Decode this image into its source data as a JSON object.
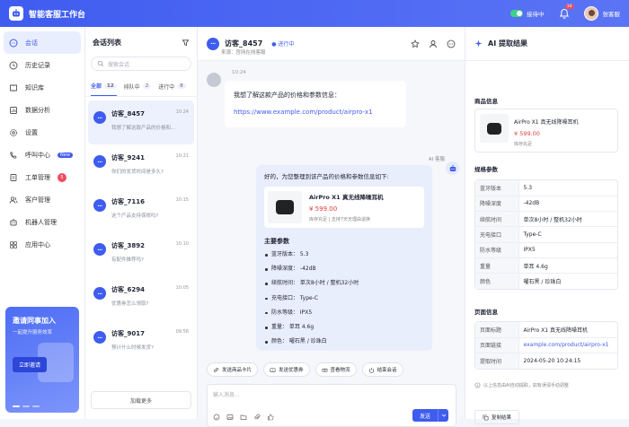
{
  "app": {
    "title": "智能客服工作台"
  },
  "header": {
    "status_label": "接待中",
    "notification_count": "10",
    "username": "张客服"
  },
  "sidebar": {
    "items": [
      {
        "label": "会话",
        "icon": "chat-icon"
      },
      {
        "label": "历史记录",
        "icon": "clock-icon"
      },
      {
        "label": "知识库",
        "icon": "book-icon"
      },
      {
        "label": "数据分析",
        "icon": "chart-icon"
      },
      {
        "label": "设置",
        "icon": "gear-icon"
      },
      {
        "label": "呼叫中心",
        "icon": "phone-icon",
        "badge": "New"
      },
      {
        "label": "工单管理",
        "icon": "ticket-icon",
        "badge": "5"
      },
      {
        "label": "客户管理",
        "icon": "users-icon"
      },
      {
        "label": "机器人管理",
        "icon": "robot-icon"
      },
      {
        "label": "应用中心",
        "icon": "apps-icon"
      }
    ],
    "promo": {
      "title": "邀请同事加入",
      "subtitle": "一起提升服务效率",
      "button": "立即邀请"
    }
  },
  "conversations": {
    "title": "会话列表",
    "search_placeholder": "搜索会话",
    "tabs": [
      {
        "label": "全部",
        "count": "12"
      },
      {
        "label": "排队中",
        "count": "2"
      },
      {
        "label": "进行中",
        "count": "8"
      }
    ],
    "items": [
      {
        "name": "访客_8457",
        "message": "我想了解这款产品的价格和...",
        "time": "10:24"
      },
      {
        "name": "访客_9241",
        "message": "你们的发货时间是多久?",
        "time": "10:21"
      },
      {
        "name": "访客_7116",
        "message": "这个产品支持保修吗?",
        "time": "10:15"
      },
      {
        "name": "访客_3892",
        "message": "有配件推荐吗?",
        "time": "10:10"
      },
      {
        "name": "访客_6294",
        "message": "优惠券怎么领取?",
        "time": "10:05"
      },
      {
        "name": "访客_9017",
        "message": "预计什么时候发货?",
        "time": "09:58"
      }
    ],
    "load_more": "加载更多"
  },
  "chat": {
    "visitor": "访客_8457",
    "status": "进行中",
    "source": "来源：官网在线客服",
    "time": "10:24",
    "user_message": "我想了解这款产品的价格和参数信息：",
    "user_link": "https://www.example.com/product/airpro-x1",
    "ai_label": "AI 客服",
    "ai_intro": "好的，为您整理到该产品的价格和参数信息如下:",
    "product": {
      "name": "AirPro X1 真无线降噪耳机",
      "price": "¥ 599.00",
      "note": "库存充足 | 支持7天无理由退换"
    },
    "params_title": "主要参数",
    "params": [
      "蓝牙版本： 5.3",
      "降噪深度： -42dB",
      "续航时间： 单次8小时 / 整机32小时",
      "充电接口： Type-C",
      "防水等级： IPX5",
      "重量： 单耳 4.6g",
      "颜色： 曜石黑 / 珍珠白"
    ],
    "quick_actions": [
      {
        "label": "发送商品卡片",
        "icon": "link-icon"
      },
      {
        "label": "发送优惠券",
        "icon": "coupon-icon"
      },
      {
        "label": "查看物流",
        "icon": "truck-icon"
      },
      {
        "label": "结束会话",
        "icon": "power-icon"
      }
    ],
    "input_placeholder": "输入消息...",
    "send_label": "发送"
  },
  "ai_panel": {
    "title": "AI 提取结果",
    "goods_section": "商品信息",
    "goods": {
      "name": "AirPro X1 真无线降噪耳机",
      "price": "¥ 599.00",
      "stock": "库存充足"
    },
    "spec_section": "规格参数",
    "specs": [
      {
        "k": "蓝牙版本",
        "v": "5.3"
      },
      {
        "k": "降噪深度",
        "v": "-42dB"
      },
      {
        "k": "续航时间",
        "v": "单次8小时 / 整机32小时"
      },
      {
        "k": "充电接口",
        "v": "Type-C"
      },
      {
        "k": "防水等级",
        "v": "IPX5"
      },
      {
        "k": "重量",
        "v": "单耳 4.6g"
      },
      {
        "k": "颜色",
        "v": "曜石黑 / 珍珠白"
      }
    ],
    "page_section": "页面信息",
    "page": [
      {
        "k": "页面标题",
        "v": "AirPro X1 真无线降噪耳机"
      },
      {
        "k": "页面链接",
        "v": "example.com/product/airpro-x1"
      },
      {
        "k": "提取时间",
        "v": "2024-05-20 10:24:15"
      }
    ],
    "note": "以上信息由AI自动提取，如有误请手动调整",
    "copy_label": "复制结果"
  },
  "colors": {
    "accent": "#3f5cf0",
    "price": "#e23b3b",
    "badge": "#f04d5f",
    "online": "#3fd08a"
  }
}
